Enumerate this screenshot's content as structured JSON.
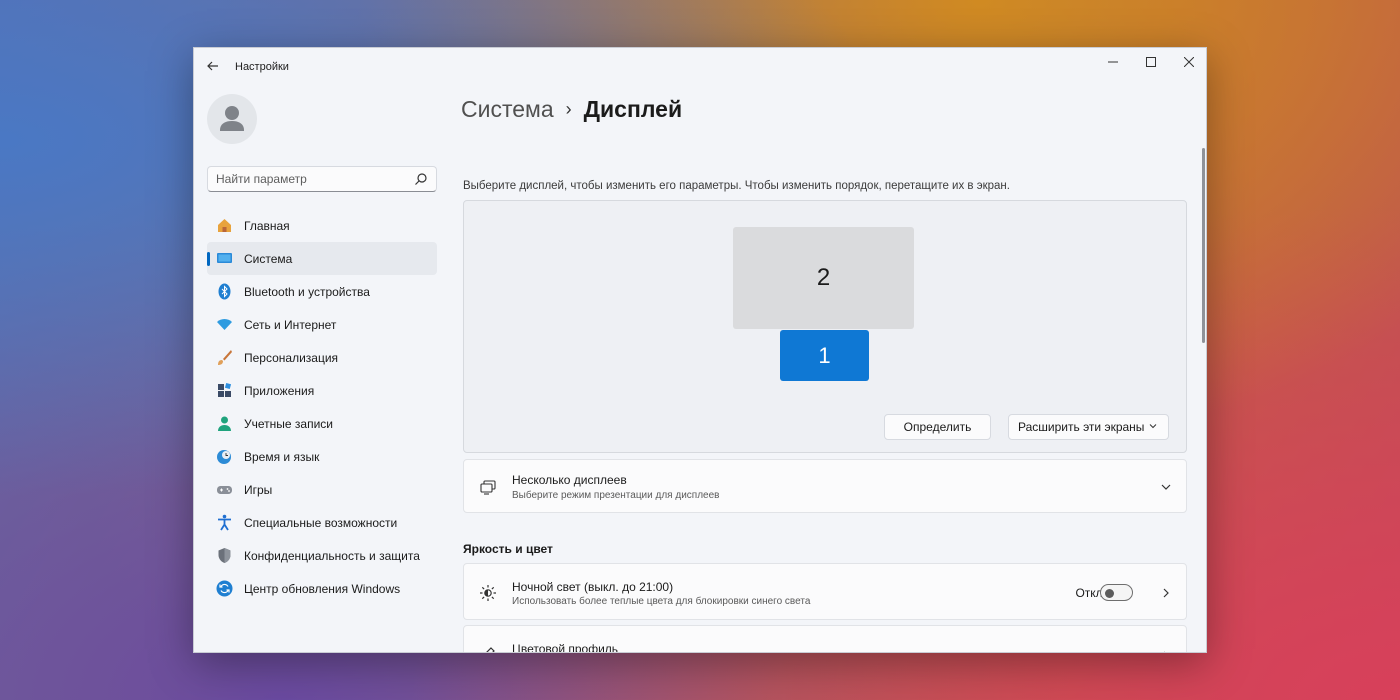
{
  "app": {
    "title": "Настройки"
  },
  "search": {
    "placeholder": "Найти параметр"
  },
  "sidebar": {
    "items": [
      {
        "label": "Главная",
        "icon": "home-icon",
        "active": false
      },
      {
        "label": "Система",
        "icon": "system-monitor-icon",
        "active": true
      },
      {
        "label": "Bluetooth и устройства",
        "icon": "bluetooth-icon",
        "active": false
      },
      {
        "label": "Сеть и Интернет",
        "icon": "wifi-icon",
        "active": false
      },
      {
        "label": "Персонализация",
        "icon": "brush-icon",
        "active": false
      },
      {
        "label": "Приложения",
        "icon": "apps-icon",
        "active": false
      },
      {
        "label": "Учетные записи",
        "icon": "user-icon",
        "active": false
      },
      {
        "label": "Время и язык",
        "icon": "globe-clock-icon",
        "active": false
      },
      {
        "label": "Игры",
        "icon": "gamepad-icon",
        "active": false
      },
      {
        "label": "Специальные возможности",
        "icon": "accessibility-icon",
        "active": false
      },
      {
        "label": "Конфиденциальность и защита",
        "icon": "shield-icon",
        "active": false
      },
      {
        "label": "Центр обновления Windows",
        "icon": "update-icon",
        "active": false
      }
    ]
  },
  "breadcrumb": {
    "parent": "Система",
    "separator": "›",
    "current": "Дисплей"
  },
  "display": {
    "hint": "Выберите дисплей, чтобы изменить его параметры. Чтобы изменить порядок, перетащите их в экран.",
    "monitors": [
      {
        "label": "2",
        "selected": false
      },
      {
        "label": "1",
        "selected": true
      }
    ],
    "identify_label": "Определить",
    "mode_selected": "Расширить эти экраны"
  },
  "multi_display": {
    "title": "Несколько дисплеев",
    "subtitle": "Выберите режим презентации для дисплеев"
  },
  "brightness_section": {
    "title": "Яркость и цвет"
  },
  "night_light": {
    "title": "Ночной свет (выкл. до 21:00)",
    "subtitle": "Использовать более теплые цвета для блокировки синего света",
    "state_label": "Откл.",
    "enabled": false
  },
  "color_profile": {
    "title": "Цветовой профиль"
  },
  "colors": {
    "accent": "#0067c0",
    "selected_monitor": "#0f78d4",
    "other_monitor": "#dadbdd"
  }
}
